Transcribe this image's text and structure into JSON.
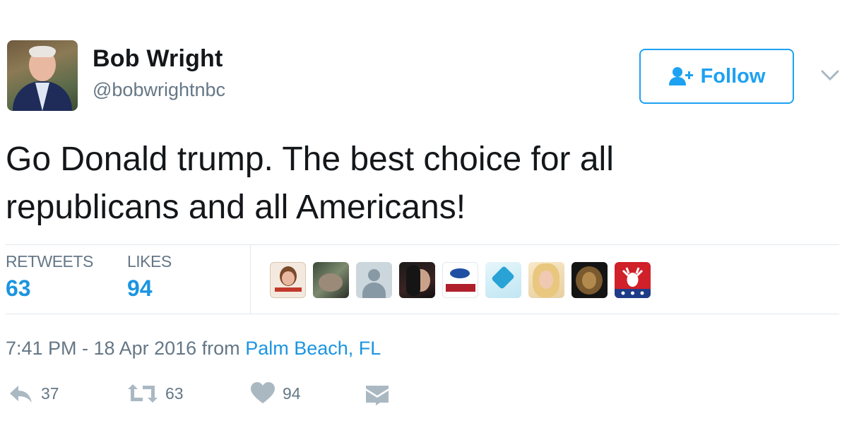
{
  "user": {
    "name": "Bob Wright",
    "handle": "@bobwrightnbc"
  },
  "follow_button": {
    "label": "Follow"
  },
  "tweet": {
    "text_line1": "Go Donald trump. The best choice for all",
    "text_line2": "republicans and all Americans!"
  },
  "stats": {
    "retweets_label": "RETWEETS",
    "retweets_value": "63",
    "likes_label": "LIKES",
    "likes_value": "94"
  },
  "likers": [
    {
      "icon": "liker-avatar-1"
    },
    {
      "icon": "liker-avatar-2"
    },
    {
      "icon": "liker-avatar-default"
    },
    {
      "icon": "liker-avatar-4"
    },
    {
      "icon": "liker-avatar-5"
    },
    {
      "icon": "liker-avatar-6"
    },
    {
      "icon": "liker-avatar-7"
    },
    {
      "icon": "liker-avatar-lion"
    },
    {
      "icon": "liker-avatar-elk"
    }
  ],
  "meta": {
    "time": "7:41 PM - 18 Apr 2016 from ",
    "place": "Palm Beach, FL"
  },
  "actions": {
    "reply_count": "37",
    "retweet_count": "63",
    "like_count": "94"
  },
  "colors": {
    "accent": "#1da1f2",
    "link": "#1b95e0",
    "muted": "#657786",
    "icon_gray": "#aab8c2"
  }
}
